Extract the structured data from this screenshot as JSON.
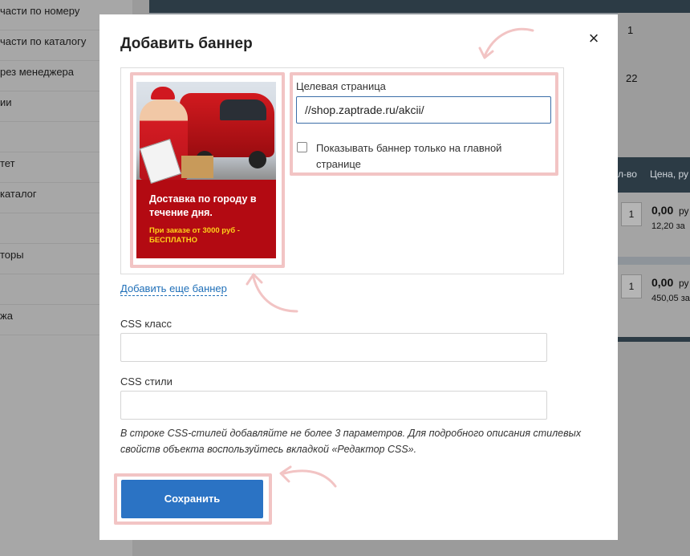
{
  "background": {
    "sidebar_items": [
      "части по номеру",
      "части по каталогу",
      "рез менеджера",
      "ии",
      "",
      "тет",
      "каталог",
      "",
      "торы",
      "",
      "жа"
    ],
    "table_partial": {
      "row1_qty": "1",
      "row2_qty": "22",
      "col_qty": "л-во",
      "col_price": "Цена, ру",
      "item1": {
        "qty": "1",
        "price": "0,00",
        "price_unit": "ру",
        "sub": "12,20 за"
      },
      "item2": {
        "qty": "1",
        "price": "0,00",
        "price_unit": "ру",
        "sub": "450,05 за"
      }
    }
  },
  "modal": {
    "title": "Добавить баннер",
    "close_symbol": "×",
    "banner": {
      "headline": "Доставка по городу в течение дня.",
      "promo": "При заказе от 3000 руб - БЕСПЛАТНО"
    },
    "target_page": {
      "label": "Целевая страница",
      "value": "//shop.zaptrade.ru/akcii/"
    },
    "show_on_main_only": {
      "label": "Показывать баннер только на главной странице",
      "checked": false
    },
    "add_more_link": "Добавить еще баннер",
    "css_class": {
      "label": "CSS класс",
      "value": ""
    },
    "css_styles": {
      "label": "CSS стили",
      "value": ""
    },
    "help_text": "В строке CSS-стилей добавляйте не более 3 параметров. Для подробного описания стилевых свойств объекта воспользуйтесь вкладкой «Редактор CSS».",
    "save_button": "Сохранить"
  },
  "colors": {
    "highlight": "#f2c4c4",
    "primary_button": "#2b73c4",
    "link": "#1f6fb8",
    "banner_red": "#b30a12",
    "promo_yellow": "#ffd21a"
  },
  "icons": [
    "close-icon",
    "arrow-annotation-icon"
  ]
}
